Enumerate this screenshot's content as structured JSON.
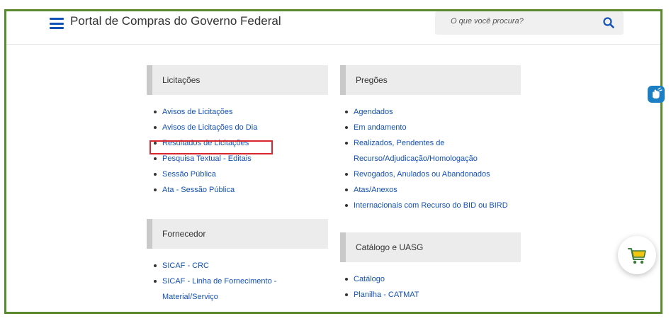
{
  "header": {
    "title": "Portal de Compras do Governo Federal",
    "search_placeholder": "O que você procura?"
  },
  "sections": {
    "licitacoes": {
      "title": "Licitações",
      "items": [
        "Avisos de Licitações",
        "Avisos de Licitações do Dia",
        "Resultados de Licitações",
        "Pesquisa Textual - Editais",
        "Sessão Pública",
        "Ata - Sessão Pública"
      ]
    },
    "pregoes": {
      "title": "Pregões",
      "items": [
        "Agendados",
        "Em andamento",
        "Realizados, Pendentes de",
        "Recurso/Adjudicação/Homologação",
        "Revogados, Anulados ou Abandonados",
        "Atas/Anexos",
        "Internacionais com Recurso do BID ou BIRD"
      ]
    },
    "fornecedor": {
      "title": "Fornecedor",
      "items": [
        "SICAF - CRC",
        "SICAF - Linha de Fornecimento -",
        "Material/Serviço"
      ]
    },
    "catalogo": {
      "title": "Catálogo e UASG",
      "items": [
        "Catálogo",
        "Planilha - CATMAT"
      ]
    }
  },
  "colors": {
    "link": "#1351b4",
    "frame_border": "#5a8a2e",
    "highlight": "#d7262e",
    "header_accent": "#1351b4"
  },
  "icons": [
    "hamburger-menu-icon",
    "search-icon",
    "accessibility-hand-icon",
    "shopping-cart-icon"
  ]
}
